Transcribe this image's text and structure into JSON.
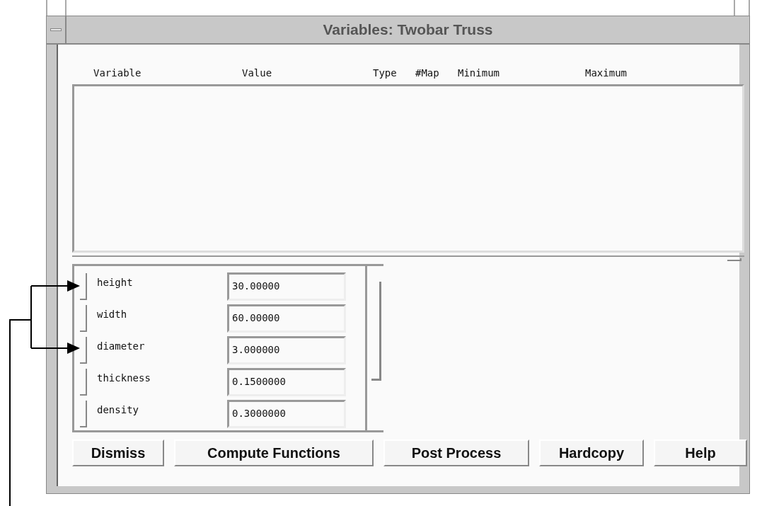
{
  "window": {
    "title": "Variables: Twobar Truss"
  },
  "columns": [
    "Variable",
    "Value",
    "Type",
    "#Map",
    "Minimum",
    "Maximum"
  ],
  "variables": [
    {
      "name": "height",
      "value": "30.00000"
    },
    {
      "name": "width",
      "value": "60.00000"
    },
    {
      "name": "diameter",
      "value": "3.000000"
    },
    {
      "name": "thickness",
      "value": "0.1500000"
    },
    {
      "name": "density",
      "value": "0.3000000"
    }
  ],
  "buttons": [
    "Dismiss",
    "Compute Functions",
    "Post Process",
    "Hardcopy",
    "Help"
  ]
}
